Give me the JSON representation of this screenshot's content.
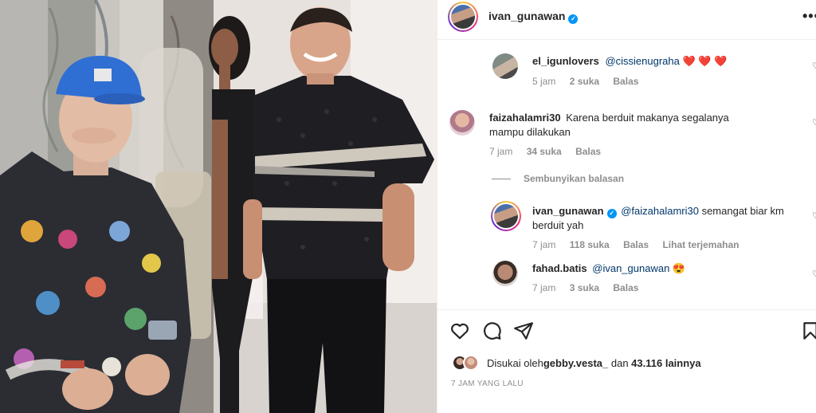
{
  "post": {
    "author": "ivan_gunawan",
    "time_ago": "7 JAM YANG LALU"
  },
  "comments": [
    {
      "username": "el_igunlovers",
      "mention": "@cissienugraha",
      "text": " ❤️ ❤️ ❤️",
      "time": "5 jam",
      "likes": "2 suka",
      "reply_label": "Balas"
    },
    {
      "username": "faizahalamri30",
      "text": "Karena berduit makanya segalanya mampu dilakukan",
      "time": "7 jam",
      "likes": "34 suka",
      "reply_label": "Balas"
    },
    {
      "username": "ivan_gunawan",
      "mention": "@faizahalamri30",
      "text": " semangat biar km berduit yah",
      "time": "7 jam",
      "likes": "118 suka",
      "reply_label": "Balas",
      "translate_label": "Lihat terjemahan"
    },
    {
      "username": "fahad.batis",
      "mention": "@ivan_gunawan",
      "text": " 😍",
      "time": "7 jam",
      "likes": "3 suka",
      "reply_label": "Balas"
    }
  ],
  "hide_replies_label": "Sembunyikan balasan",
  "likes_summary": {
    "prefix": "Disukai oleh ",
    "user": "gebby.vesta_",
    "middle": " dan ",
    "count": "43.116 lainnya"
  },
  "icons": [
    "heart-icon",
    "comment-icon",
    "share-icon",
    "bookmark-icon",
    "more-icon",
    "verified-icon"
  ],
  "colors": {
    "verified": "#0095f6",
    "mention": "#00376b",
    "muted": "#8e8e8e"
  }
}
